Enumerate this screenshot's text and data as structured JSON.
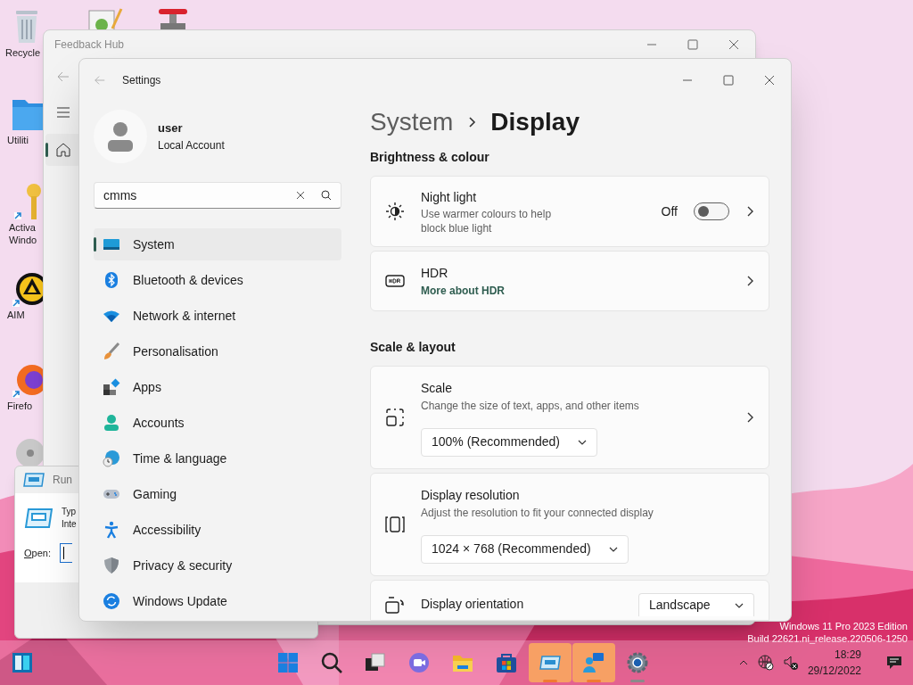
{
  "desktop_icons": [
    {
      "kind": "trash",
      "lines": [
        "Recycle"
      ]
    },
    {
      "kind": "notepad"
    },
    {
      "kind": "valve"
    },
    {
      "kind": "folder",
      "lines": [
        "Utiliti"
      ]
    },
    {
      "kind": "key",
      "lines": [
        "Activa",
        "Windo"
      ]
    },
    {
      "kind": "triangle",
      "lines": [
        "AIM"
      ]
    },
    {
      "kind": "browser",
      "lines": [
        "Firefo"
      ]
    },
    {
      "kind": "disc"
    }
  ],
  "feedback_hub": {
    "title": "Feedback Hub",
    "home_selected": true
  },
  "run_dialog": {
    "title": "Run",
    "prompt_lines": [
      "Typ",
      "Inte"
    ],
    "open_label": "Open:"
  },
  "settings": {
    "title": "Settings",
    "user": {
      "name": "user",
      "account": "Local Account"
    },
    "search": {
      "value": "cmms"
    },
    "nav": [
      {
        "kind": "system",
        "label": "System",
        "selected": true
      },
      {
        "kind": "bluetooth",
        "label": "Bluetooth & devices",
        "selected": false
      },
      {
        "kind": "network",
        "label": "Network & internet",
        "selected": false
      },
      {
        "kind": "brush",
        "label": "Personalisation",
        "selected": false
      },
      {
        "kind": "apps",
        "label": "Apps",
        "selected": false
      },
      {
        "kind": "person",
        "label": "Accounts",
        "selected": false
      },
      {
        "kind": "globe",
        "label": "Time & language",
        "selected": false
      },
      {
        "kind": "gamepad",
        "label": "Gaming",
        "selected": false
      },
      {
        "kind": "accessibility",
        "label": "Accessibility",
        "selected": false
      },
      {
        "kind": "shield",
        "label": "Privacy & security",
        "selected": false
      },
      {
        "kind": "update",
        "label": "Windows Update",
        "selected": false
      }
    ],
    "breadcrumb": [
      "System",
      "Display"
    ],
    "sections": [
      {
        "title": "Brightness & colour",
        "cards": [
          {
            "kind": "toggle",
            "title": "Night light",
            "description": "Use warmer colours to help block blue light",
            "state_label": "Off",
            "on": false
          },
          {
            "kind": "link",
            "title": "HDR",
            "link": "More about HDR"
          }
        ]
      },
      {
        "title": "Scale & layout",
        "cards": [
          {
            "kind": "dropdown",
            "title": "Scale",
            "description": "Change the size of text, apps, and other items",
            "value": "100% (Recommended)"
          },
          {
            "kind": "dropdown",
            "title": "Display resolution",
            "description": "Adjust the resolution to fit your connected display",
            "value": "1024 × 768 (Recommended)"
          },
          {
            "kind": "inline",
            "title": "Display orientation",
            "value": "Landscape"
          }
        ]
      }
    ]
  },
  "edition_watermark": [
    "Windows 11 Pro 2023 Edition",
    "Build 22621.ni_release.220506-1250"
  ],
  "taskbar": {
    "apps": [
      {
        "kind": "windows",
        "flashing": false,
        "running": false
      },
      {
        "kind": "search",
        "flashing": false,
        "running": false
      },
      {
        "kind": "taskview",
        "flashing": false,
        "running": false
      },
      {
        "kind": "meet",
        "flashing": false,
        "running": false
      },
      {
        "kind": "explorer",
        "flashing": false,
        "running": false
      },
      {
        "kind": "store",
        "flashing": false,
        "running": false
      },
      {
        "kind": "run",
        "flashing": true,
        "running": true
      },
      {
        "kind": "feedback",
        "flashing": true,
        "running": true
      },
      {
        "kind": "settings",
        "flashing": false,
        "running": true
      }
    ],
    "time": "18:29",
    "date": "29/12/2022"
  }
}
